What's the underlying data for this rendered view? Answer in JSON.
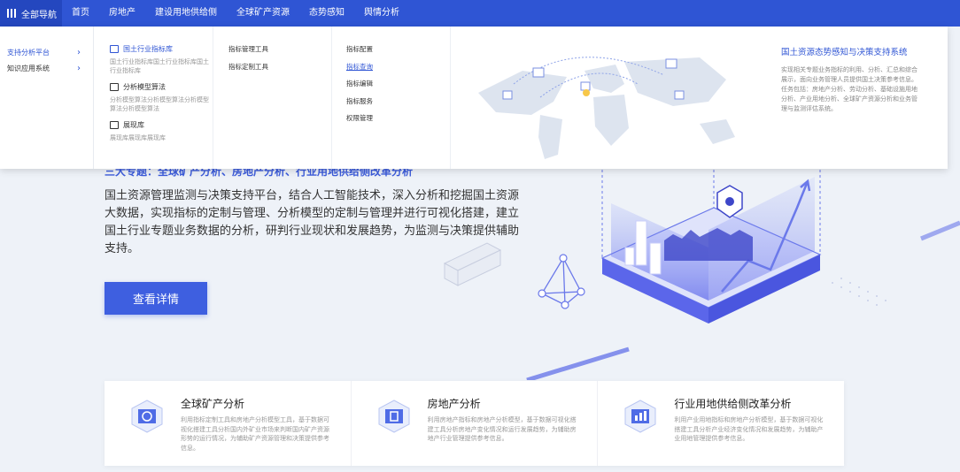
{
  "nav": {
    "all_label": "全部导航",
    "items": [
      "首页",
      "房地产",
      "建设用地供给侧",
      "全球矿产资源",
      "态势感知",
      "舆情分析"
    ]
  },
  "dropdown": {
    "left_items": [
      {
        "label": "支持分析平台"
      },
      {
        "label": "知识应用系统"
      }
    ],
    "groups": [
      {
        "title": "国土行业指标库",
        "desc": "国土行业指标库国土行业指标库国土行业指标库"
      },
      {
        "title": "分析模型算法",
        "desc": "分析模型算法分析模型算法分析模型算法分析模型算法"
      },
      {
        "title": "展现库",
        "desc": "展现库展现库展现库"
      }
    ],
    "col2": [
      "指标管理工具",
      "指标定制工具"
    ],
    "col3": [
      "指标配置",
      "指标查询",
      "指标编辑",
      "指标服务",
      "权限管理"
    ],
    "info_title": "国土资源态势感知与决策支持系统",
    "info_desc": "实现相关专题业务指标的利用、分析、汇总和综合展示，面向业务管理人员提供国土决策参考信息。任务包括：房地产分析、劳动分析、基础设施用地分析、产业用地分析、全球矿产资源分析和业务管理与监测评估系统。"
  },
  "hero": {
    "subtitle": "三大专题：全球矿产分析、房地产分析、行业用地供给侧改革分析",
    "description": "国土资源管理监测与决策支持平台，结合人工智能技术，深入分析和挖掘国土资源大数据，实现指标的定制与管理、分析模型的定制与管理并进行可视化搭建，建立国土行业专题业务数据的分析，研判行业现状和发展趋势，为监测与决策提供辅助支持。",
    "button": "查看详情"
  },
  "cards": [
    {
      "title": "全球矿产分析",
      "desc": "利用指标定制工具和房地产分析模型工具，基于数据可视化搭建工具分析国内外矿业市场来判断国内矿产资源形势的运行情况，为辅助矿产资源管理和决策提供参考信息。"
    },
    {
      "title": "房地产分析",
      "desc": "利用房地产指标和房地产分析模型，基于数据可视化搭建工具分析房地产变化情况和运行发展趋势，为辅助房地产行业管理提供参考信息。"
    },
    {
      "title": "行业用地供给侧改革分析",
      "desc": "利用产业用地指标和房地产分析模型，基于数据可视化搭建工具分析产业经济变化情况和发展趋势，为辅助产业用地管理提供参考信息。"
    }
  ],
  "colors": {
    "primary": "#2f55d4",
    "button": "#3e5fe0",
    "background": "#eef2f8"
  }
}
